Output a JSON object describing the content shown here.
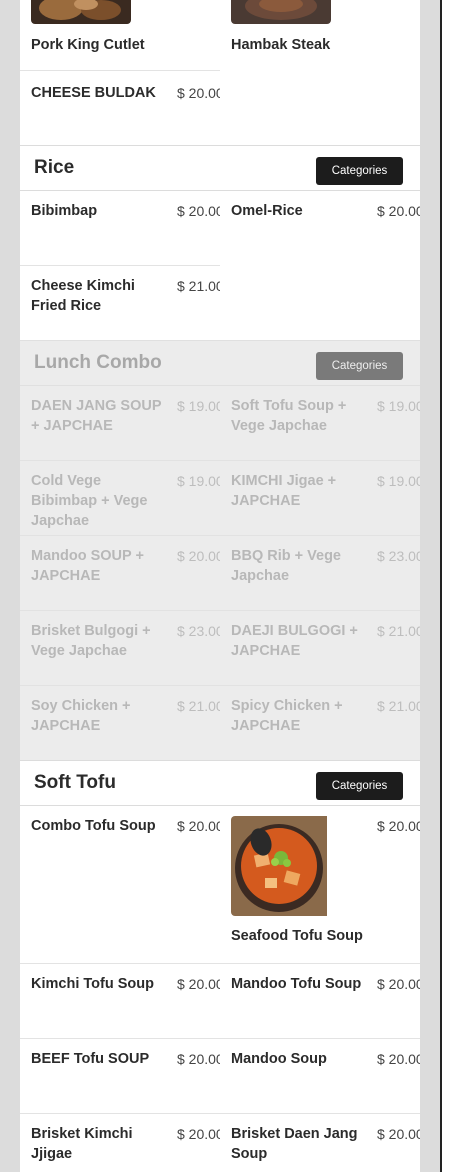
{
  "top_section": {
    "items": [
      {
        "name": "Pork King Cutlet",
        "price": ""
      },
      {
        "name": "Hambak Steak",
        "price": ""
      },
      {
        "name": "CHEESE BULDAK",
        "price": "$ 20.00"
      }
    ]
  },
  "rice": {
    "title": "Rice",
    "button": "Categories",
    "items": [
      {
        "name": "Bibimbap",
        "price": "$ 20.00"
      },
      {
        "name": "Omel-Rice",
        "price": "$ 20.00"
      },
      {
        "name": "Cheese Kimchi Fried Rice",
        "price": "$ 21.00"
      }
    ]
  },
  "lunch_combo": {
    "title": "Lunch Combo",
    "button": "Categories",
    "items": [
      {
        "name": "DAEN JANG SOUP + JAPCHAE",
        "price": "$ 19.00"
      },
      {
        "name": "Soft Tofu Soup + Vege Japchae",
        "price": "$ 19.00"
      },
      {
        "name": "Cold Vege Bibimbap + Vege Japchae",
        "price": "$ 19.00"
      },
      {
        "name": "KIMCHI Jigae + JAPCHAE",
        "price": "$ 19.00"
      },
      {
        "name": "Mandoo SOUP + JAPCHAE",
        "price": "$ 20.00"
      },
      {
        "name": "BBQ Rib + Vege Japchae",
        "price": "$ 23.00"
      },
      {
        "name": "Brisket Bulgogi + Vege Japchae",
        "price": "$ 23.00"
      },
      {
        "name": "DAEJI BULGOGI + JAPCHAE",
        "price": "$ 21.00"
      },
      {
        "name": "Soy Chicken + JAPCHAE",
        "price": "$ 21.00"
      },
      {
        "name": "Spicy Chicken + JAPCHAE",
        "price": "$ 21.00"
      }
    ]
  },
  "soft_tofu": {
    "title": "Soft Tofu",
    "button": "Categories",
    "items": [
      {
        "name": "Combo Tofu Soup",
        "price": "$ 20.00"
      },
      {
        "name": "Seafood Tofu Soup",
        "price": "$ 20.00"
      },
      {
        "name": "Kimchi Tofu Soup",
        "price": "$ 20.00"
      },
      {
        "name": "Mandoo Tofu Soup",
        "price": "$ 20.00"
      },
      {
        "name": "BEEF Tofu SOUP",
        "price": "$ 20.00"
      },
      {
        "name": "Mandoo Soup",
        "price": "$ 20.00"
      },
      {
        "name": "Brisket Kimchi Jjigae",
        "price": "$ 20.00"
      },
      {
        "name": "Brisket Daen Jang Soup",
        "price": "$ 20.00"
      }
    ]
  },
  "colors": {
    "button_bg": "#1c1c1c",
    "dim_button_bg": "#7a7a7a",
    "dim_bg": "#ececec"
  }
}
